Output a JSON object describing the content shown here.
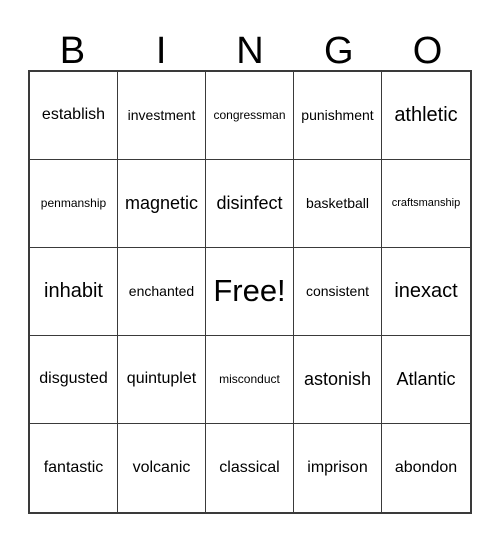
{
  "card": {
    "title": "BINGO",
    "header_letters": [
      "B",
      "I",
      "N",
      "G",
      "O"
    ],
    "grid_size": "5x5",
    "free_space_label": "Free!",
    "colors": {
      "background": "#ffffff",
      "grid_line": "#3a3a3a",
      "text": "#000000"
    },
    "rows": [
      [
        {
          "label": "establish",
          "size": "lg"
        },
        {
          "label": "investment",
          "size": "md"
        },
        {
          "label": "congressman",
          "size": "sm"
        },
        {
          "label": "punishment",
          "size": "md"
        },
        {
          "label": "athletic",
          "size": "xxl"
        }
      ],
      [
        {
          "label": "penmanship",
          "size": "sm"
        },
        {
          "label": "magnetic",
          "size": "xl"
        },
        {
          "label": "disinfect",
          "size": "xl"
        },
        {
          "label": "basketball",
          "size": "md"
        },
        {
          "label": "craftsmanship",
          "size": "xs"
        }
      ],
      [
        {
          "label": "inhabit",
          "size": "xxl"
        },
        {
          "label": "enchanted",
          "size": "md"
        },
        {
          "label": "Free!",
          "size": "free"
        },
        {
          "label": "consistent",
          "size": "md"
        },
        {
          "label": "inexact",
          "size": "xxl"
        }
      ],
      [
        {
          "label": "disgusted",
          "size": "lg"
        },
        {
          "label": "quintuplet",
          "size": "lg"
        },
        {
          "label": "misconduct",
          "size": "sm"
        },
        {
          "label": "astonish",
          "size": "xl"
        },
        {
          "label": "Atlantic",
          "size": "xl"
        }
      ],
      [
        {
          "label": "fantastic",
          "size": "lg"
        },
        {
          "label": "volcanic",
          "size": "lg"
        },
        {
          "label": "classical",
          "size": "lg"
        },
        {
          "label": "imprison",
          "size": "lg"
        },
        {
          "label": "abondon",
          "size": "lg"
        }
      ]
    ]
  }
}
